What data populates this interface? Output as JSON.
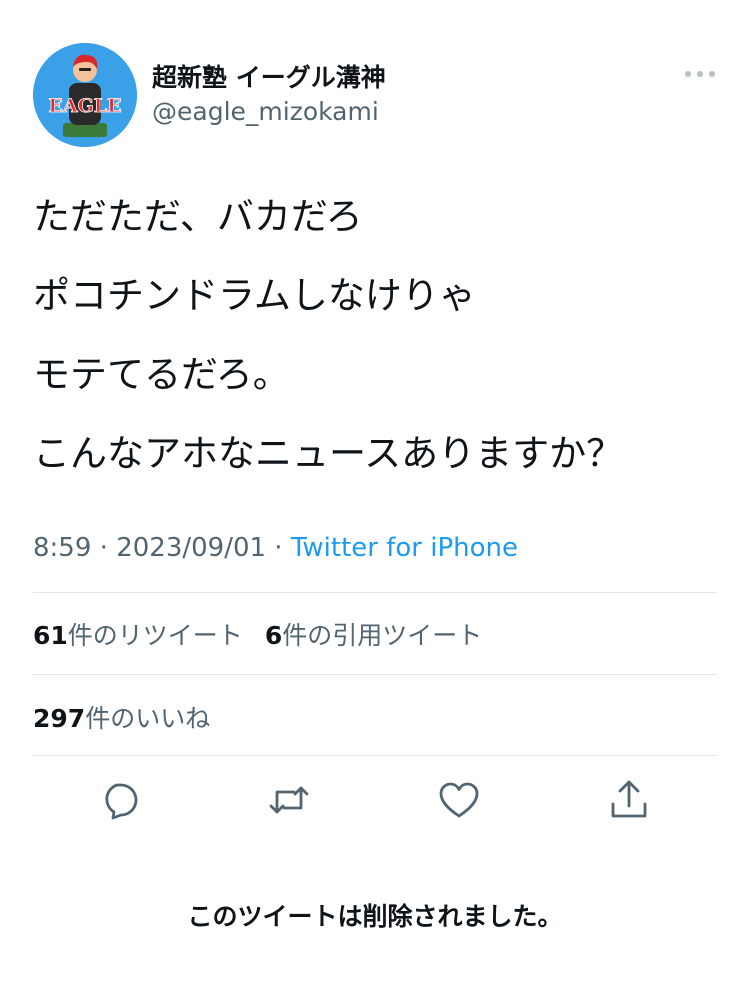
{
  "author": {
    "display_name": "超新塾 イーグル溝神",
    "handle": "@eagle_mizokami",
    "avatar_text": "EAGLE"
  },
  "tweet": {
    "lines": [
      "ただただ、バカだろ",
      "ポコチンドラムしなけりゃ",
      "モテてるだろ。",
      "こんなアホなニュースありますか？"
    ],
    "time": "8:59",
    "date": "2023/09/01",
    "source": "Twitter for iPhone"
  },
  "stats": {
    "retweets_count": "61",
    "retweets_label": "件のリツイート",
    "quotes_count": "6",
    "quotes_label": "件の引用ツイート",
    "likes_count": "297",
    "likes_label": "件のいいね"
  },
  "actions": [
    "reply-icon",
    "retweet-icon",
    "like-icon",
    "share-icon"
  ],
  "deleted_notice": "このツイートは削除されました。",
  "colors": {
    "link": "#1d9bf0",
    "secondary_text": "#536471",
    "primary_text": "#0f1419",
    "divider": "#e1e6ea"
  }
}
